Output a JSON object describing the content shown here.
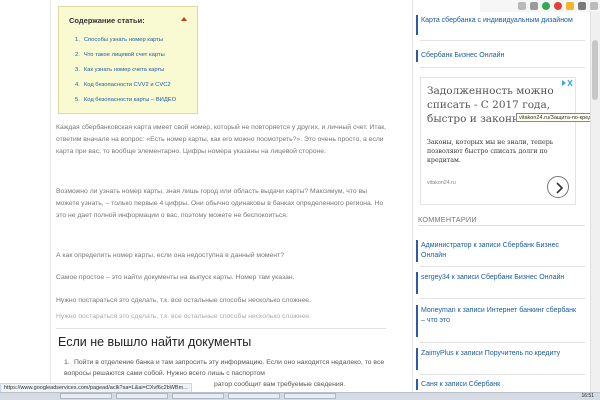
{
  "toc": {
    "title": "Содержание статьи:",
    "items": [
      {
        "num": "1.",
        "label": "Способы узнать номер карты"
      },
      {
        "num": "2.",
        "label": "Что такое лицевой счет карты"
      },
      {
        "num": "3.",
        "label": "Как узнать номер счета карты"
      },
      {
        "num": "4.",
        "label": "Код безопасности CVV2 и CVC2"
      },
      {
        "num": "5.",
        "label": "Код безопасности карты – ВИДЕО"
      }
    ]
  },
  "article": {
    "p1": "Каждая сбербанковская карта имеет свой номер, который не повторяется у других, и личный счет. Итак, ответим вначале на вопрос: «Есть номер карты, как его можно посмотреть?». Это очень просто, а если карта при вас, то вообще элементарно. Цифры номера указаны на лицевой стороне.",
    "p2": "Возможно ли узнать номер карты, зная лишь город или область выдачи карты? Максимум, что вы можете узнать, – только первые 4 цифры. Они обычно одинаковы в банках определенного региона. Но это не дает полной информации о вас, поэтому можете не беспокоиться.",
    "p3": "А как определить номер карты, если она недоступна в данный момент?",
    "p4": "Самое простое – это найти документы на выпуск карты. Номер там указан.",
    "p5": "Нужно постараться это сделать, т.к. все остальные способы несколько сложнее.",
    "p5_ghost": "Нужно постараться это сделать, т.к. все остальные способы несколько сложнее.",
    "section_heading": "Если не вышло найти документы",
    "step1_num": "1.",
    "step1_text": "Пойти в отделение банка и там запросить эту информацию. Если оно находится недалеко, то все вопросы решаются сами собой. Нужно всего лишь с паспортом",
    "step1_tail": "ратор сообщит вам требуемые сведения."
  },
  "sidebar": {
    "link1": "Карта сбербанка с индивидуальным дизайном",
    "link2": "Сбербанк Бизнес Онлайн",
    "comments_title": "КОММЕНТАРИИ",
    "comments": [
      "Администратор к записи Сбербанк Бизнес Онлайн",
      "sergey34 к записи Сбербанк Бизнес Онлайн",
      "Moneyman к записи Интернет банкинг сбербанк – что это",
      "ZaimyPlus к записи Поручитель по кредиту",
      "Саня к записи Сбербанк"
    ]
  },
  "ad": {
    "headline": "Задолженность можно списать - С 2017 года, быстро и законно",
    "tooltip": "vitakon24.ru/Защита-по-кредитам",
    "body": "Законы, которых мы не знали, теперь позволяют быстро списать долги по кредитам.",
    "domain": "vitakon24.ru"
  },
  "browser": {
    "status_url": "https://www.googleadservices.com/pagead/aclk?sa=L&ai=CXvf6c2bWBm...",
    "clock": "16:51"
  },
  "colors": {
    "link": "#1a5b9e",
    "toc_bg": "#fafad2",
    "accent_bar": "#2f5aa8",
    "toggle": "#c0392b"
  }
}
